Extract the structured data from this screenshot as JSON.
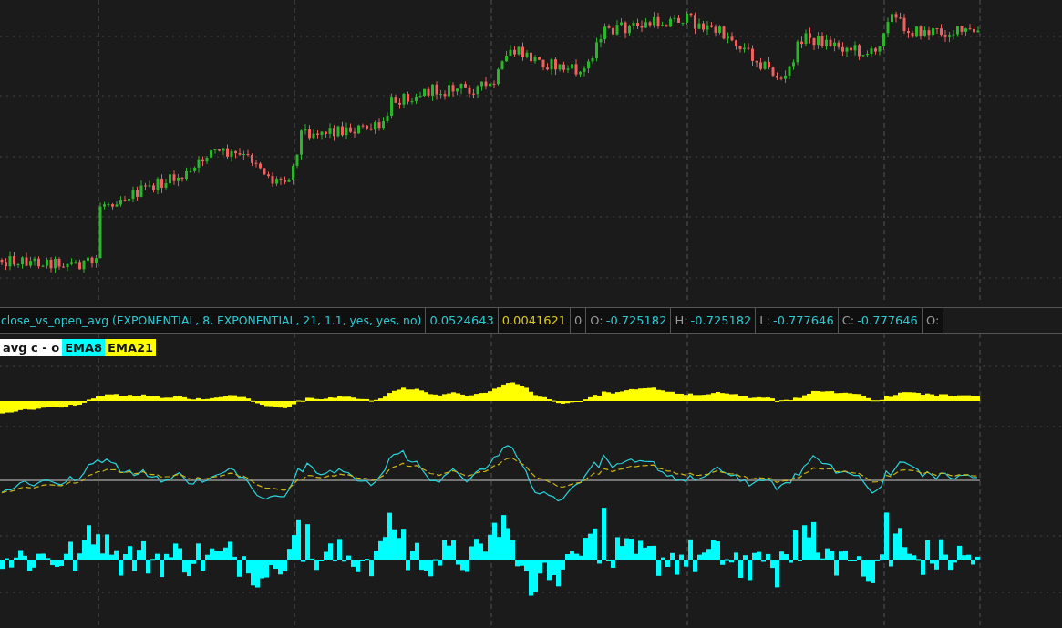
{
  "study_header": {
    "title": "close_vs_open_avg (EXPONENTIAL, 8, EXPONENTIAL, 21, 1.1, yes, yes, no)",
    "values": [
      {
        "text": "0.0524643",
        "color": "#2ec9d0"
      },
      {
        "text": "0.0041621",
        "color": "#d9c91e"
      },
      {
        "text": "0",
        "color": "#9a9a9a"
      }
    ],
    "readouts": [
      {
        "label": "O:",
        "value": "-0.725182"
      },
      {
        "label": "H:",
        "value": "-0.725182"
      },
      {
        "label": "L:",
        "value": "-0.777646"
      },
      {
        "label": "C:",
        "value": "-0.777646"
      },
      {
        "label": "O:"
      }
    ]
  },
  "legend": [
    {
      "text": "avg c - o",
      "color": "#ffffff"
    },
    {
      "text": "EMA8",
      "color": "#00ffff"
    },
    {
      "text": "EMA21",
      "color": "#ffff00"
    }
  ]
}
